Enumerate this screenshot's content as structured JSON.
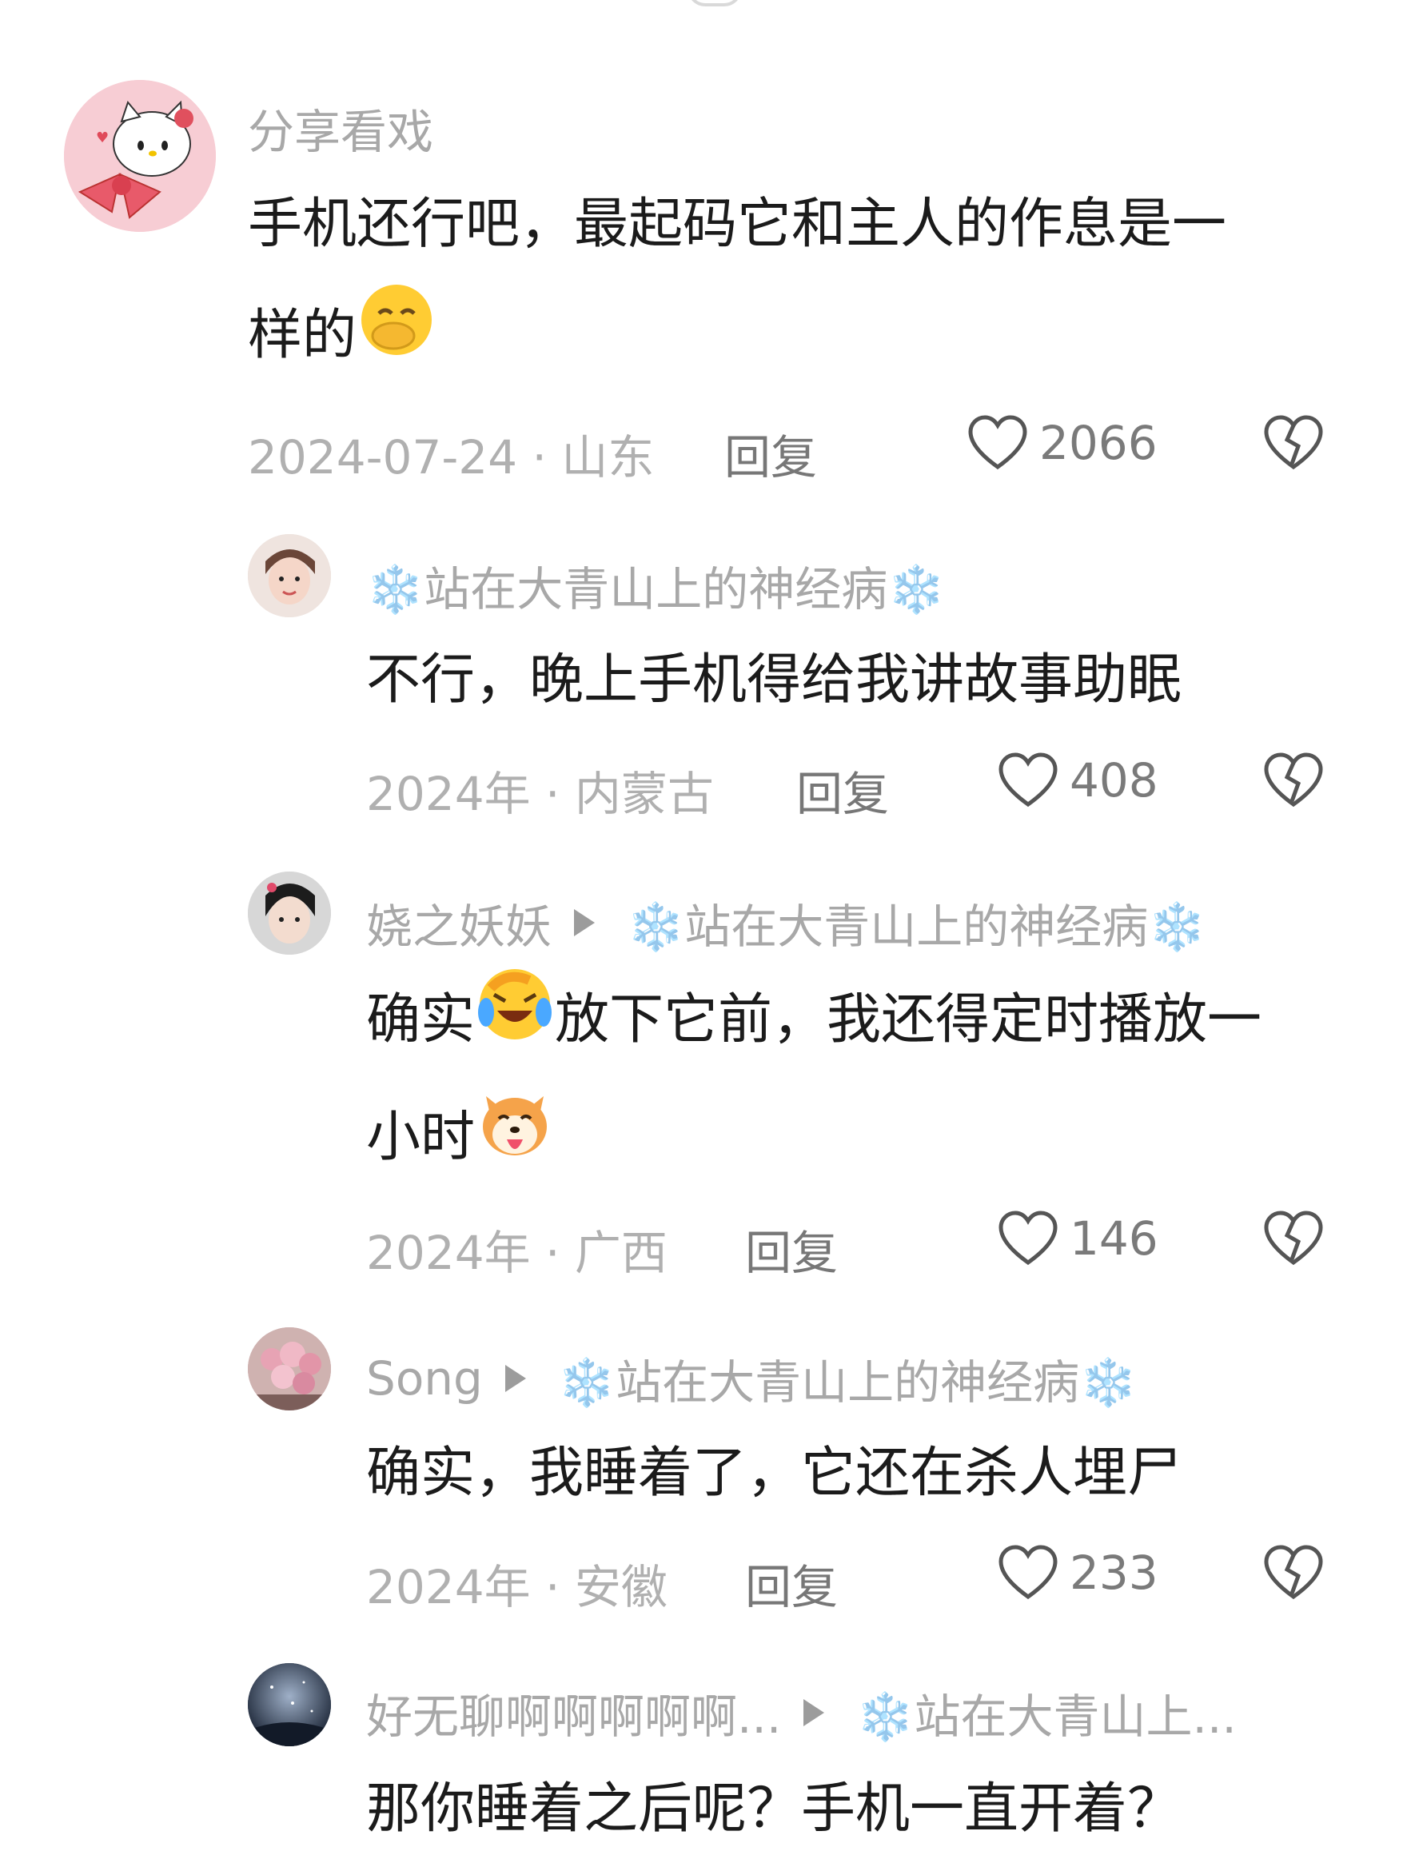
{
  "comments": [
    {
      "author": "分享看戏",
      "text_line1": "手机还行吧，最起码它和主人的作息是一",
      "text_line2": "样的",
      "date": "2024-07-24",
      "location": "山东",
      "reply_label": "回复",
      "likes": "2066",
      "emoji": "face-with-hand-over-mouth",
      "avatar": "hello-kitty-avatar"
    }
  ],
  "replies": [
    {
      "author": "❄️站在大青山上的神经病❄️",
      "reply_to": "",
      "text_line1": "不行，晚上手机得给我讲故事助眠",
      "date": "2024年",
      "location": "内蒙古",
      "reply_label": "回复",
      "likes": "408"
    },
    {
      "author": "娆之妖妖",
      "reply_to": "❄️站在大青山上的神经病❄️",
      "text_line1a": "确实",
      "text_line1b": "放下它前，我还得定时播放一",
      "text_line2": "小时",
      "date": "2024年",
      "location": "广西",
      "reply_label": "回复",
      "likes": "146",
      "emoji1": "crying-laughing-face",
      "emoji2": "shiba-tongue-face"
    },
    {
      "author": "Song",
      "reply_to": "❄️站在大青山上的神经病❄️",
      "text_line1": "确实，我睡着了，它还在杀人埋尸",
      "date": "2024年",
      "location": "安徽",
      "reply_label": "回复",
      "likes": "233"
    },
    {
      "author": "好无聊啊啊啊啊啊...",
      "reply_to": "❄️站在大青山上...",
      "text_line1": "那你睡着之后呢？手机一直开着？"
    }
  ],
  "colors": {
    "meta_gray": "#b0b0b0",
    "name_gray": "#a8a8a8",
    "text": "#1b1b1b",
    "snow_blue": "#b9c9dc"
  },
  "icons": [
    "heart-outline-icon",
    "broken-heart-icon",
    "play-triangle-icon",
    "snowflake-icon"
  ]
}
